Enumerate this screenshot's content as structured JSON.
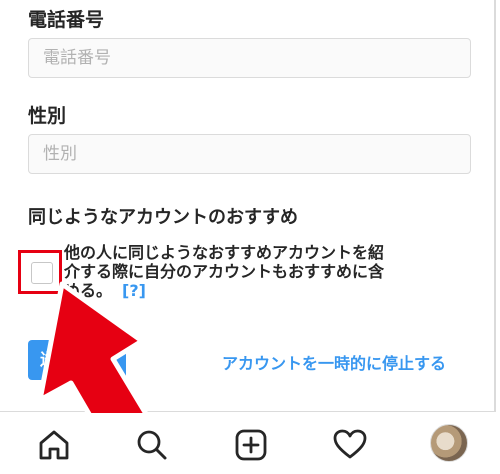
{
  "form": {
    "phone": {
      "label": "電話番号",
      "placeholder": "電話番号",
      "value": ""
    },
    "gender": {
      "label": "性別",
      "placeholder": "性別",
      "value": ""
    },
    "suggestions": {
      "title": "同じようなアカウントのおすすめ",
      "description": "他の人に同じようなおすすめアカウントを紹介する際に自分のアカウントもおすすめに含める。",
      "help_link": "[?]",
      "checked": false
    },
    "submit_label": "送信",
    "deactivate_link": "アカウントを一時的に停止する"
  },
  "bottom_nav": {
    "items": [
      {
        "name": "home",
        "icon": "home-icon"
      },
      {
        "name": "search",
        "icon": "search-icon"
      },
      {
        "name": "new-post",
        "icon": "plus-square-icon"
      },
      {
        "name": "activity",
        "icon": "heart-icon"
      },
      {
        "name": "profile",
        "icon": "avatar"
      }
    ]
  },
  "annotation": {
    "highlight_color": "#e60012"
  }
}
